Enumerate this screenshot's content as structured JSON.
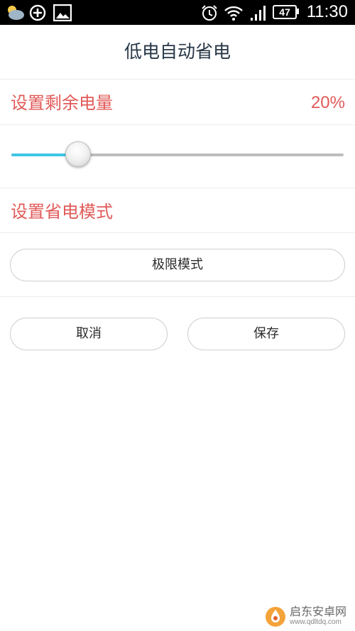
{
  "status_bar": {
    "battery_level": "47",
    "time": "11:30",
    "icons": [
      "weather-icon",
      "plus-circle-icon",
      "image-icon",
      "alarm-icon",
      "wifi-icon",
      "signal-icon",
      "battery-icon"
    ]
  },
  "header": {
    "title": "低电自动省电"
  },
  "battery_threshold": {
    "label": "设置剩余电量",
    "value_text": "20%",
    "slider_fraction": 0.2
  },
  "mode": {
    "label": "设置省电模式",
    "selected": "极限模式"
  },
  "actions": {
    "cancel_label": "取消",
    "save_label": "保存"
  },
  "watermark": {
    "name": "启东安卓网",
    "url": "www.qdltdq.com"
  },
  "colors": {
    "accent_red": "#e05a58",
    "slider_fill": "#3fc6e6",
    "title_text": "#263646"
  }
}
